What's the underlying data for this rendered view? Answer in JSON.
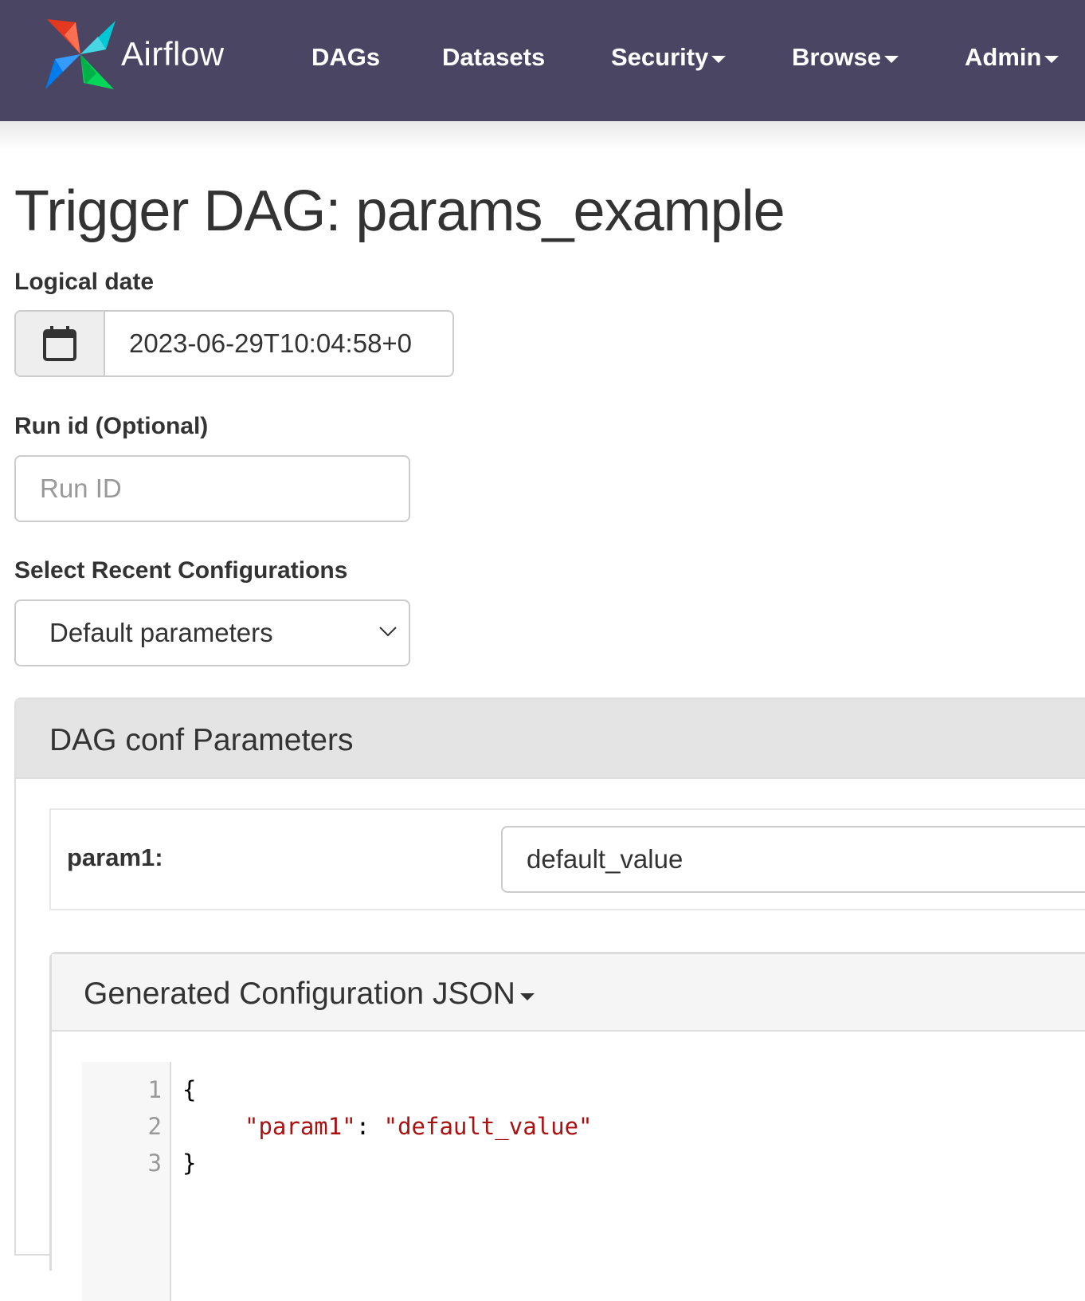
{
  "navbar": {
    "brand": "Airflow",
    "items": [
      {
        "label": "DAGs",
        "has_dropdown": false
      },
      {
        "label": "Datasets",
        "has_dropdown": false
      },
      {
        "label": "Security",
        "has_dropdown": true
      },
      {
        "label": "Browse",
        "has_dropdown": true
      },
      {
        "label": "Admin",
        "has_dropdown": true
      }
    ],
    "colors": {
      "background": "#4a4563",
      "text": "#ffffff"
    }
  },
  "page": {
    "title": "Trigger DAG: params_example"
  },
  "form": {
    "logical_date": {
      "label": "Logical date",
      "value": "2023-06-29T10:04:58+0",
      "icon": "calendar-icon"
    },
    "run_id": {
      "label": "Run id (Optional)",
      "placeholder": "Run ID",
      "value": ""
    },
    "recent_configs": {
      "label": "Select Recent Configurations",
      "selected": "Default parameters",
      "icon": "chevron-down-icon"
    }
  },
  "conf_panel": {
    "title": "DAG conf Parameters",
    "params": [
      {
        "label": "param1:",
        "value": "default_value"
      }
    ]
  },
  "json_panel": {
    "title": "Generated Configuration JSON",
    "lines": [
      {
        "num": "1",
        "text": "{"
      },
      {
        "num": "2",
        "key": "\"param1\"",
        "sep": ": ",
        "value": "\"default_value\""
      },
      {
        "num": "3",
        "text": "}"
      }
    ],
    "colors": {
      "string": "#aa1111"
    }
  }
}
